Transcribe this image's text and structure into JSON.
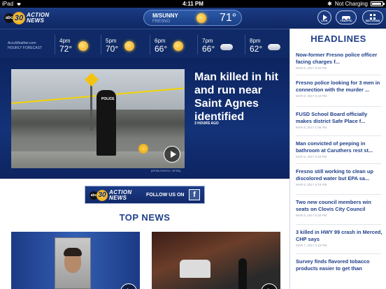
{
  "status_bar": {
    "device": "iPad",
    "time": "4:11 PM",
    "charging": "Not Charging",
    "bluetooth": "✱"
  },
  "brand": {
    "abc": "abc",
    "channel": "30",
    "name_line1": "ACTION",
    "name_line2": "NEWS"
  },
  "weather": {
    "condition": "M/SUNNY",
    "city": "FRESNO",
    "temp": "71°"
  },
  "nav": {
    "live": "LIVE",
    "traffic": "TRAFFIC",
    "sections": "SECTIONS"
  },
  "forecast": {
    "credit_line1": "AccuWeather.com",
    "credit_line2": "HOURLY FORECAST",
    "items": [
      {
        "time": "4pm",
        "temp": "72°",
        "icon": "sun-icon"
      },
      {
        "time": "5pm",
        "temp": "70°",
        "icon": "sun-icon"
      },
      {
        "time": "6pm",
        "temp": "66°",
        "icon": "sun-icon"
      },
      {
        "time": "7pm",
        "temp": "66°",
        "icon": "cloud-icon"
      },
      {
        "time": "8pm",
        "temp": "62°",
        "icon": "cloud-icon"
      }
    ]
  },
  "hero": {
    "title": "Man killed in hit and run near Saint Agnes identified",
    "time_ago": "3 HOURS AGO",
    "photo_credit": "(KFSN PHOTO / KFSN)",
    "officer_label": "POLICE"
  },
  "social": {
    "follow_text": "FOLLOW US ON",
    "fb_glyph": "f"
  },
  "top_news": {
    "label": "TOP NEWS"
  },
  "headlines": {
    "title": "HEADLINES",
    "items": [
      {
        "text": "Now-former Fresno police officer facing charges f...",
        "date": "MAR 8, 2017 5:20 PM"
      },
      {
        "text": "Fresno police looking for 3 men in connection with the murder ...",
        "date": "MAR 8, 2017 6:19 PM"
      },
      {
        "text": "FUSD School Board officially makes district Safe Place f...",
        "date": "MAR 8, 2017 1:08 AM"
      },
      {
        "text": "Man convicted of peeping in bathroom at Caruthers rest st...",
        "date": "MAR 8, 2017 5:23 PM"
      },
      {
        "text": "Fresno still working to clean up discolored water but EPA sa...",
        "date": "MAR 8, 2017 6:19 PM"
      },
      {
        "text": "Two new council members win seats on Clovis City Council",
        "date": "MAR 8, 2017 6:30 PM"
      },
      {
        "text": "3 killed in HWY 99 crash in Merced, CHP says",
        "date": "MAR 7, 2017 4:15 PM"
      },
      {
        "text": "Survey finds flavored tobacco products easier to get than",
        "date": ""
      }
    ]
  }
}
